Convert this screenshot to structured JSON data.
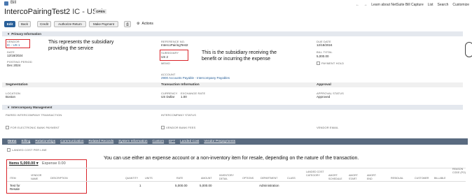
{
  "header": {
    "record_type": "Bill",
    "record_title": "IntercoPairingTest2",
    "subsidiary_code": "IC - US 1",
    "status": "OPEN",
    "top_links": [
      "Learn about NetSuite Bill Capture",
      "List",
      "Search",
      "Customize"
    ]
  },
  "toolbar": {
    "edit": "Edit",
    "back": "Back",
    "credit": "Credit",
    "authorize_return": "Authorize Return",
    "make_payment": "Make Payment",
    "actions": "Actions"
  },
  "primary": {
    "section_title": "Primary Information",
    "vendor_label": "VENDOR",
    "vendor_value": "IC - US 1",
    "date_label": "DATE",
    "date_value": "12/18/2024",
    "posting_label": "POSTING PERIOD",
    "posting_value": "Dec 2024",
    "ref_label": "REFERENCE NO.",
    "ref_value": "IntercoPairingTest2",
    "sub_label": "SUBSIDIARY",
    "sub_value": "US 2",
    "memo_label": "MEMO",
    "account_label": "ACCOUNT",
    "account_value": "2900 Accounts Payable - Intercompany Payables",
    "due_label": "DUE DATE",
    "due_value": "12/18/2024",
    "total_label": "BILL TOTAL",
    "total_value": "5,000.00",
    "hold_label": "PAYMENT HOLD"
  },
  "notes": {
    "vendor_note": "This represents the subsidiary providing the service",
    "sub_note": "This is the subsidiary receiving the benefit or incurring the expense",
    "items_note": "You can use either an expense account or a non-inventory item for resale, depending on the nature of the transaction."
  },
  "segmentation": {
    "title": "Segmentation",
    "location_label": "LOCATION",
    "location_value": "Boston"
  },
  "transaction": {
    "title": "Transaction Information",
    "currency_label": "CURRENCY",
    "currency_value": "US Dollar",
    "rate_label": "EXCHANGE RATE",
    "rate_value": "1.00"
  },
  "approval": {
    "title": "Approval",
    "status_label": "APPROVAL STATUS",
    "status_value": "Approved"
  },
  "interco": {
    "title": "Intercompany Management",
    "paired_label": "PAIRED INTERCOMPANY TRANSACTION",
    "status_label": "INTERCOMPANY STATUS",
    "eft_label": "FOR ELECTRONIC BANK PAYMENT",
    "fees_label": "VENDOR BANK FEES",
    "email_label": "VENDOR EMAIL"
  },
  "tabs": [
    "Items",
    "Billing",
    "Relationships",
    "Communication",
    "Related Records",
    "System Information",
    "Custom",
    "EFT",
    "Landed Cost",
    "Vendor Prepayments"
  ],
  "items": {
    "landed_cost_label": "LANDED COST PER LINE",
    "items_tab": "Items 5,000.00",
    "expense_tab": "Expense 0.00",
    "columns": [
      "ITEM",
      "VENDOR NAME",
      "DESCRIPTION",
      "QUANTITY",
      "UNITS",
      "RATE",
      "AMOUNT",
      "INVENTORY DETAIL",
      "OPTIONS",
      "DEPARTMENT",
      "CLASS",
      "LANDED COST CATEGORY",
      "AMORT. SCHEDULE",
      "AMORT. START",
      "AMORT. END",
      "RESIDUAL",
      "CUSTOMER",
      "BILLABLE",
      "REASON CODE (PO)"
    ],
    "row": {
      "item": "Test for Resale",
      "quantity": "1",
      "rate": "5,000.00",
      "amount": "5,000.00",
      "department": "Administration"
    }
  },
  "colors": {
    "accent": "#2a6099",
    "tab_bar": "#5a6b80",
    "highlight": "#d9242a"
  }
}
